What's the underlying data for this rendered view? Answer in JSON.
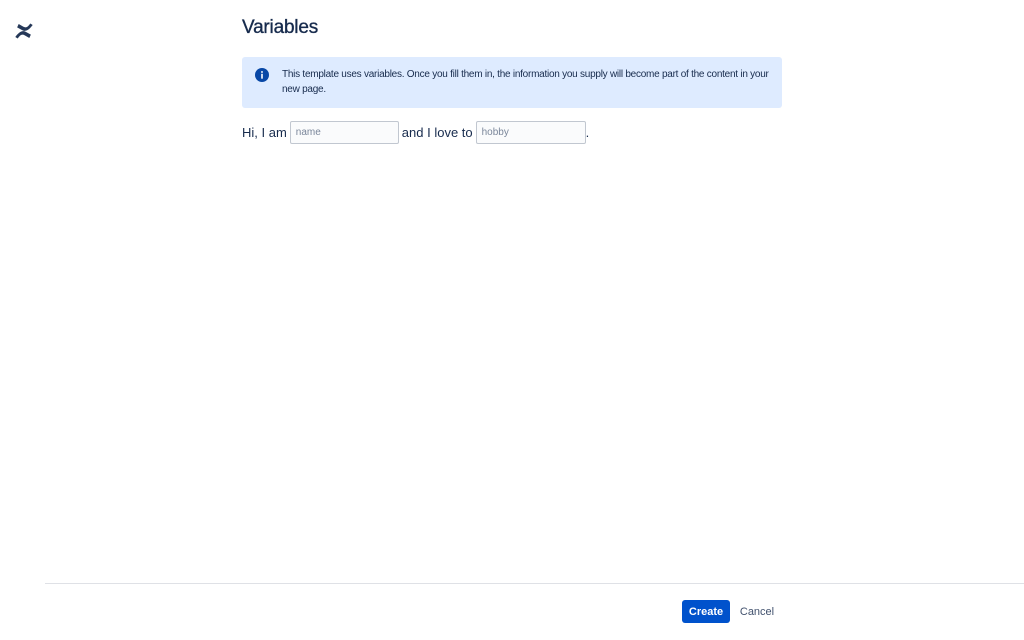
{
  "app": {
    "logo_icon": "confluence-logo-icon"
  },
  "page": {
    "title": "Variables"
  },
  "info_panel": {
    "icon": "info-icon",
    "text": "This template uses variables. Once you fill them in, the information you supply will become part of the content in your new page."
  },
  "template": {
    "prefix": "Hi, I am",
    "name_placeholder": "name",
    "name_value": "",
    "middle": "and I love to",
    "hobby_placeholder": "hobby",
    "hobby_value": "",
    "suffix": "."
  },
  "footer": {
    "create_label": "Create",
    "cancel_label": "Cancel"
  },
  "colors": {
    "primary": "#0052cc",
    "info_background": "#deebff",
    "info_icon": "#0747a6",
    "text": "#172b4d"
  }
}
